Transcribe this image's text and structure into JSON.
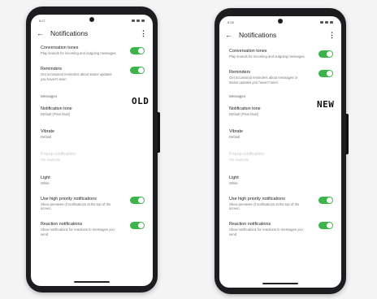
{
  "colors": {
    "accent": "#3bb54a",
    "frame": "#1d1d1f"
  },
  "old": {
    "tag": "OLD",
    "status_time": "8:27",
    "title": "Notifications",
    "rows": {
      "conversation_tones": {
        "title": "Conversation tones",
        "sub": "Play sounds for incoming and outgoing messages."
      },
      "reminders": {
        "title": "Reminders",
        "sub": "Get occasional reminders about status updates you haven't seen"
      },
      "section": "Messages",
      "notification_tone": {
        "title": "Notification tone",
        "sub": "Default (Pixie Dust)"
      },
      "vibrate": {
        "title": "Vibrate",
        "sub": "Default"
      },
      "popup": {
        "title": "Popup notification",
        "sub": "Not available"
      },
      "light": {
        "title": "Light",
        "sub": "White"
      },
      "high_priority": {
        "title": "Use high priority notifications",
        "sub": "Show previews of notifications at the top of the screen"
      },
      "reaction": {
        "title": "Reaction notifications",
        "sub": "Show notifications for reactions to messages you send"
      }
    }
  },
  "new": {
    "tag": "NEW",
    "status_time": "8:28",
    "title": "Notifications",
    "rows": {
      "conversation_tones": {
        "title": "Conversation tones",
        "sub": "Play sounds for incoming and outgoing messages."
      },
      "reminders": {
        "title": "Reminders",
        "sub": "Get occasional reminders about messages or status updates you haven't seen"
      },
      "section": "Messages",
      "notification_tone": {
        "title": "Notification tone",
        "sub": "Default (Pixie Dust)"
      },
      "vibrate": {
        "title": "Vibrate",
        "sub": "Default"
      },
      "popup": {
        "title": "Popup notification",
        "sub": "Not available"
      },
      "light": {
        "title": "Light",
        "sub": "White"
      },
      "high_priority": {
        "title": "Use high priority notifications",
        "sub": "Show previews of notifications at the top of the screen"
      },
      "reaction": {
        "title": "Reaction notifications",
        "sub": "Show notifications for reactions to messages you send"
      }
    }
  }
}
